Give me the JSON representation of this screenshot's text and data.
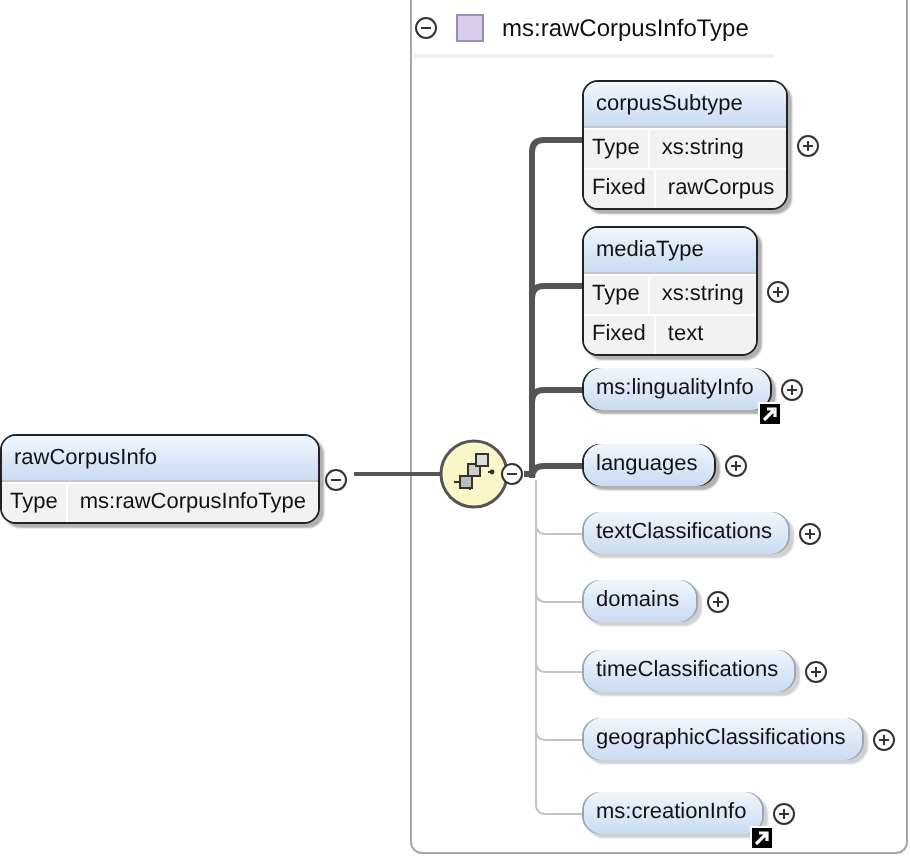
{
  "root": {
    "name": "rawCorpusInfo",
    "expanded": true,
    "rows": [
      {
        "label": "Type",
        "value": "ms:rawCorpusInfoType"
      }
    ]
  },
  "type": {
    "name": "ms:rawCorpusInfoType",
    "expanded": true,
    "children": [
      {
        "name": "corpusSubtype",
        "required": true,
        "reference": false,
        "expanded": false,
        "rows": [
          {
            "label": "Type",
            "value": "xs:string"
          },
          {
            "label": "Fixed",
            "value": "rawCorpus"
          }
        ]
      },
      {
        "name": "mediaType",
        "required": true,
        "reference": false,
        "expanded": false,
        "rows": [
          {
            "label": "Type",
            "value": "xs:string"
          },
          {
            "label": "Fixed",
            "value": "text"
          }
        ]
      },
      {
        "name": "ms:lingualityInfo",
        "required": true,
        "reference": true,
        "expanded": false
      },
      {
        "name": "languages",
        "required": true,
        "reference": false,
        "expanded": false
      },
      {
        "name": "textClassifications",
        "required": false,
        "reference": false,
        "expanded": false
      },
      {
        "name": "domains",
        "required": false,
        "reference": false,
        "expanded": false
      },
      {
        "name": "timeClassifications",
        "required": false,
        "reference": false,
        "expanded": false
      },
      {
        "name": "geographicClassifications",
        "required": false,
        "reference": false,
        "expanded": false
      },
      {
        "name": "ms:creationInfo",
        "required": false,
        "reference": true,
        "expanded": false
      }
    ]
  }
}
